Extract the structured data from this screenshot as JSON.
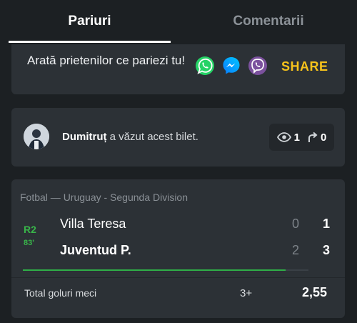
{
  "tabs": [
    {
      "label": "Pariuri",
      "active": true
    },
    {
      "label": "Comentarii",
      "active": false
    }
  ],
  "share": {
    "text": "Arată prietenilor ce pariezi tu!",
    "apps": [
      "whatsapp-icon",
      "messenger-icon",
      "viber-icon"
    ],
    "button_label": "SHARE",
    "accent_color": "#f7c31b"
  },
  "viewer": {
    "name": "Dumitruț",
    "text": " a văzut acest bilet.",
    "views": "1",
    "shares": "0"
  },
  "match": {
    "league": "Fotbal — Uruguay - Segunda Division",
    "round": "R2",
    "minute": "83'",
    "status_color": "#39b54a",
    "progress": 0.92,
    "home": {
      "name": "Villa Teresa",
      "ht": "0",
      "ft": "1"
    },
    "away": {
      "name": "Juventud P.",
      "ht": "2",
      "ft": "3"
    }
  },
  "bet": {
    "market": "Total goluri meci",
    "pick": "3+",
    "odds": "2,55"
  }
}
